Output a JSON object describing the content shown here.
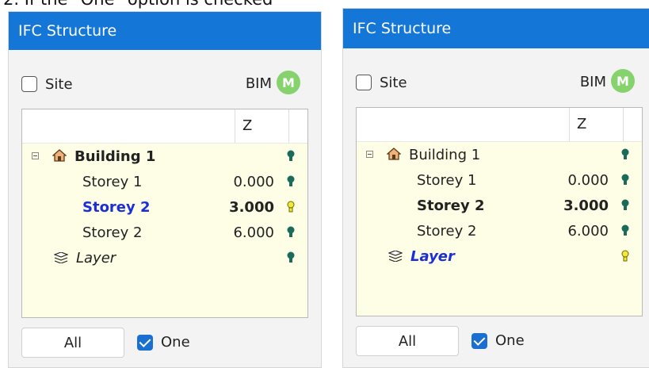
{
  "caption": "2. If the \"One\" option is checked",
  "panels": [
    {
      "title": "IFC Structure",
      "site_label": "Site",
      "bim_label": "BIM",
      "m_badge": "M",
      "z_header": "Z",
      "rows": [
        {
          "name": "Building 1",
          "z": "",
          "state": "off"
        },
        {
          "name": "Storey 1",
          "z": "0.000",
          "state": "off"
        },
        {
          "name": "Storey 2",
          "z": "3.000",
          "state": "on"
        },
        {
          "name": "Storey 2",
          "z": "6.000",
          "state": "off"
        },
        {
          "name": "Layer",
          "z": "",
          "state": "off"
        }
      ],
      "all_button": "All",
      "one_label": "One",
      "one_checked": true
    },
    {
      "title": "IFC Structure",
      "site_label": "Site",
      "bim_label": "BIM",
      "m_badge": "M",
      "z_header": "Z",
      "rows": [
        {
          "name": "Building 1",
          "z": "",
          "state": "off"
        },
        {
          "name": "Storey 1",
          "z": "0.000",
          "state": "off"
        },
        {
          "name": "Storey 2",
          "z": "3.000",
          "state": "off"
        },
        {
          "name": "Storey 2",
          "z": "6.000",
          "state": "off"
        },
        {
          "name": "Layer",
          "z": "",
          "state": "on"
        }
      ],
      "all_button": "All",
      "one_label": "One",
      "one_checked": true
    }
  ],
  "colors": {
    "titlebar": "#1476d6",
    "grid_bg": "#fefee6",
    "selected_text": "#1a2fd8",
    "bulb_off": "#1a6b5a",
    "bulb_on": "#f2e83a",
    "badge": "#86d36e"
  },
  "icons": {
    "expander": "collapse-box-icon",
    "building": "house-icon",
    "layer": "layers-icon",
    "visibility": "lightbulb-icon"
  }
}
